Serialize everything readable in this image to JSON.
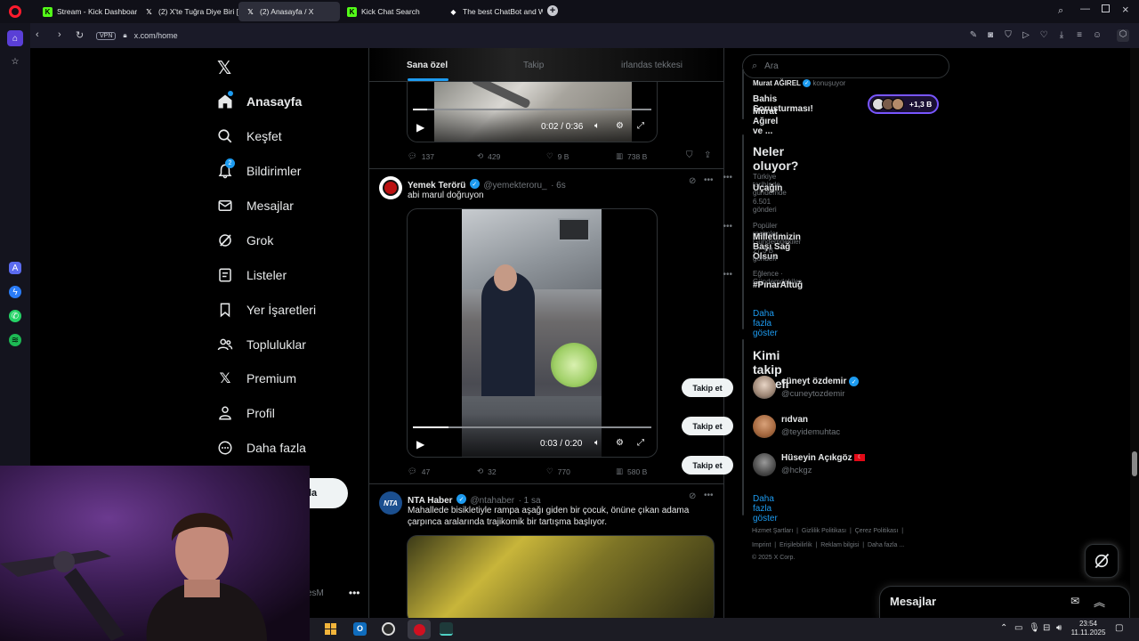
{
  "browser": {
    "tabs": [
      {
        "label": "Stream - Kick Dashboard",
        "icon": "kick-icon",
        "color": "#53fc18"
      },
      {
        "label": "(2) X'te Tuğra Diye Biri [ F",
        "icon": "x-icon",
        "color": "#ffffff"
      },
      {
        "label": "(2) Anasayfa / X",
        "icon": "x-icon",
        "color": "#ffffff"
      },
      {
        "label": "Kick Chat Search",
        "icon": "kick-icon",
        "color": "#53fc18"
      },
      {
        "label": "The best ChatBot and Wid",
        "icon": "chatbot-icon",
        "color": "#ffffff"
      }
    ],
    "vpn_label": "VPN",
    "url": "x.com/home"
  },
  "nav": {
    "items": [
      {
        "label": "Anasayfa",
        "icon": "home-icon"
      },
      {
        "label": "Keşfet",
        "icon": "search-icon"
      },
      {
        "label": "Bildirimler",
        "icon": "bell-icon",
        "badge": "2"
      },
      {
        "label": "Mesajlar",
        "icon": "mail-icon"
      },
      {
        "label": "Grok",
        "icon": "grok-icon"
      },
      {
        "label": "Listeler",
        "icon": "list-icon"
      },
      {
        "label": "Yer İşaretleri",
        "icon": "bookmark-icon"
      },
      {
        "label": "Topluluklar",
        "icon": "people-icon"
      },
      {
        "label": "Premium",
        "icon": "x-premium-icon"
      },
      {
        "label": "Profil",
        "icon": "person-icon"
      },
      {
        "label": "Daha fazla",
        "icon": "more-circle-icon"
      }
    ],
    "post_button_partial": "la",
    "account_handle_partial": "esM"
  },
  "timeline": {
    "tabs": [
      "Sana özel",
      "Takip",
      "irlandas tekkesi"
    ],
    "tweets": [
      {
        "video_time": "0:02 / 0:36",
        "progress": 0.06,
        "stats": {
          "replies": "137",
          "reposts": "429",
          "likes": "9 B",
          "views": "738 B"
        }
      },
      {
        "name": "Yemek Terörü",
        "handle": "@yemekteroru_",
        "time": "· 6s",
        "text": "abi marul doğruyon",
        "video_time": "0:03 / 0:20",
        "progress": 0.15,
        "stats": {
          "replies": "47",
          "reposts": "32",
          "likes": "770",
          "views": "580 B"
        }
      },
      {
        "name": "NTA Haber",
        "handle": "@ntahaber",
        "time": "· 1 sa",
        "text": "Mahallede bisikletiyle rampa aşağı giden bir çocuk, önüne çıkan adama çarpınca aralarında trajikomik bir tartışma başlıyor.",
        "avatar_text": "NTA"
      }
    ]
  },
  "sidebar": {
    "search_placeholder": "Ara",
    "live": {
      "host": "Murat AĞIREL",
      "suffix": "konuşuyor",
      "title_line1": "Bahis Soruşturması!",
      "title_line2": "Murat Ağırel ve ...",
      "listeners": "+1,3 B"
    },
    "trends": {
      "title": "Neler oluyor?",
      "items": [
        {
          "category": "Türkiye tarihinde gündemde",
          "name": "Uçağın",
          "count": "6.501 gönderi"
        },
        {
          "category": "Popüler resimler · Gündemdekiler",
          "name": "Milletimizin Başı Sağ Olsun",
          "count": "27,3 B gönderi"
        },
        {
          "category": "Eğlence · Gündemdekiler",
          "name": "#PınarAltuğ",
          "count": ""
        }
      ],
      "show_more": "Daha fazla göster"
    },
    "who_to_follow": {
      "title": "Kimi takip etmeli",
      "users": [
        {
          "name": "cüneyt özdemir",
          "handle": "@cuneytozdemir",
          "verified": true,
          "flag": false
        },
        {
          "name": "rıdvan",
          "handle": "@teyidemuhtac",
          "verified": false,
          "flag": false
        },
        {
          "name": "Hüseyin Açıkgöz",
          "handle": "@hckgz",
          "verified": false,
          "flag": true
        }
      ],
      "button": "Takip et",
      "show_more": "Daha fazla göster"
    },
    "footer": {
      "line1": [
        "Hizmet Şartları",
        "Gizlilik Politikası",
        "Çerez Politikası"
      ],
      "line2": [
        "Imprint",
        "Erişilebilirlik",
        "Reklam bilgisi",
        "Daha fazla ..."
      ],
      "copyright": "© 2025 X Corp."
    }
  },
  "messages_panel": {
    "title": "Mesajlar"
  },
  "taskbar": {
    "time": "23:54",
    "date": "11.11.2025"
  },
  "colors": {
    "accent": "#1d9bf0",
    "background": "#000000",
    "border": "#2f3336",
    "muted": "#71767b"
  }
}
